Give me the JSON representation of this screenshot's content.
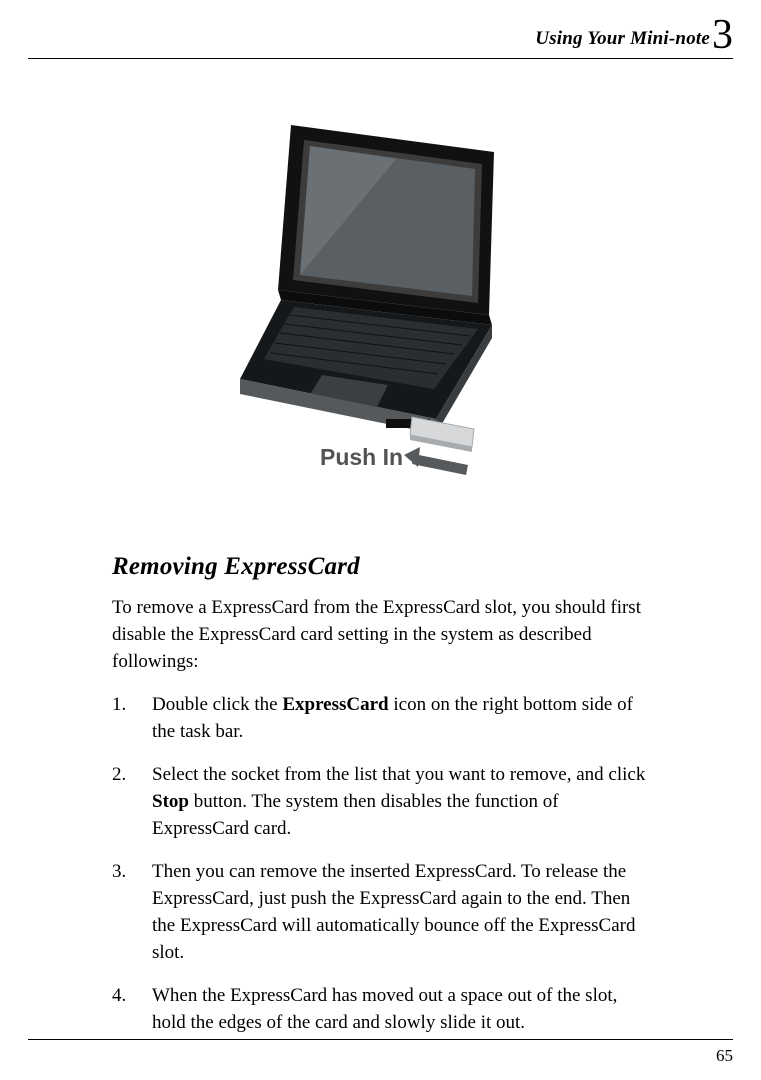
{
  "header": {
    "title": "Using Your Mini-note",
    "chapter": "3"
  },
  "figure": {
    "label": "Push In"
  },
  "section": {
    "heading": "Removing ExpressCard",
    "intro": "To remove a ExpressCard from the ExpressCard slot, you should first disable the ExpressCard card setting in the system as described followings:",
    "steps": [
      {
        "pre": "Double click the ",
        "bold": "ExpressCard",
        "post": " icon on the right bottom side of the task bar."
      },
      {
        "pre": "Select the socket from the list that you want to remove, and click ",
        "bold": "Stop",
        "post": " button. The system then disables the function of ExpressCard card."
      },
      {
        "pre": "Then you can remove the inserted ExpressCard. To release the ExpressCard, just push the ExpressCard again to the end. Then the ExpressCard will automatically bounce off the ExpressCard slot.",
        "bold": "",
        "post": ""
      },
      {
        "pre": "When the ExpressCard has moved out a space out of the slot, hold the edges of the card and slowly slide it out.",
        "bold": "",
        "post": ""
      }
    ]
  },
  "page_number": "65"
}
